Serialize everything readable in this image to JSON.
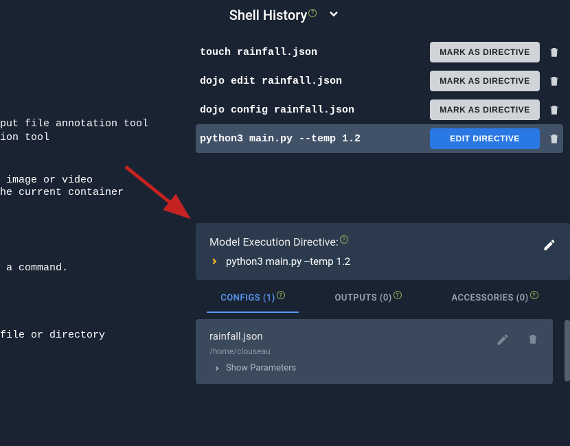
{
  "header": {
    "title": "Shell History"
  },
  "history": {
    "items": [
      {
        "cmd": "touch rainfall.json",
        "button": "MARK AS DIRECTIVE",
        "buttonType": "gray",
        "selected": false
      },
      {
        "cmd": "dojo edit rainfall.json",
        "button": "MARK AS DIRECTIVE",
        "buttonType": "gray",
        "selected": false
      },
      {
        "cmd": "dojo config rainfall.json",
        "button": "MARK AS DIRECTIVE",
        "buttonType": "gray",
        "selected": false
      },
      {
        "cmd": "python3 main.py --temp 1.2",
        "button": "EDIT DIRECTIVE",
        "buttonType": "blue",
        "selected": true
      }
    ]
  },
  "terminal": {
    "line1": "put file annotation tool",
    "line2": "ion tool",
    "line3": " image or video",
    "line4": "he current container",
    "line5": " a command.",
    "line6": "file or directory"
  },
  "directive": {
    "label": "Model Execution Directive:",
    "cmd": "python3 main.py --temp 1.2"
  },
  "tabs": {
    "configs": "CONFIGS (1)",
    "outputs": "OUTPUTS (0)",
    "accessories": "ACCESSORIES (0)"
  },
  "configCard": {
    "filename": "rainfall.json",
    "path": "/home/clouseau",
    "showParams": "Show Parameters"
  },
  "colors": {
    "accent_blue": "#2a78e4",
    "accent_gold": "#f0b429",
    "help_green": "#8aad5a",
    "arrow_red": "#c52222"
  }
}
